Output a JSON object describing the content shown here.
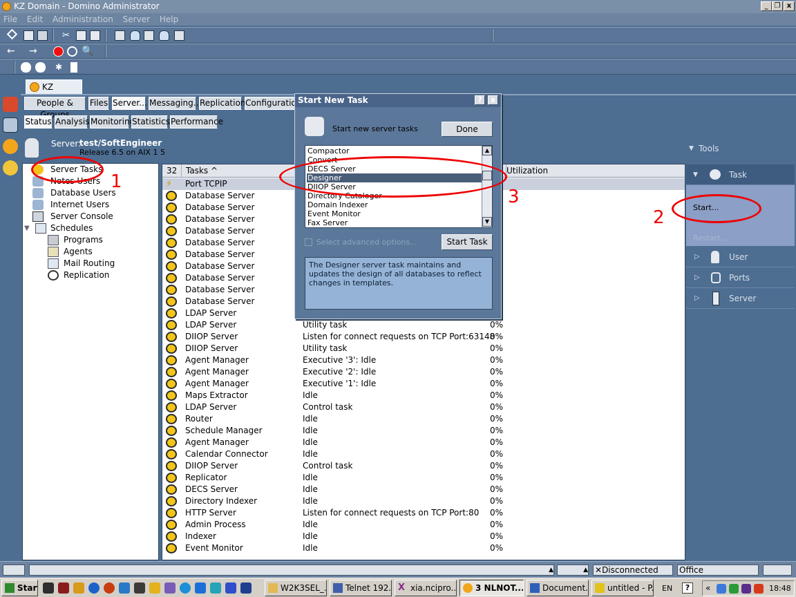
{
  "window": {
    "title": "KZ Domain - Domino Administrator",
    "min": "_",
    "max": "❐",
    "close": "x"
  },
  "menu": [
    "File",
    "Edit",
    "Administration",
    "Server",
    "Help"
  ],
  "domain_tab": "KZ Domain",
  "top_tabs": [
    "People & Groups",
    "Files",
    "Server...",
    "Messaging...",
    "Replication",
    "Configuration"
  ],
  "sub_tabs": [
    "Status",
    "Analysis",
    "Monitoring",
    "Statistics",
    "Performance"
  ],
  "server": {
    "label": "Server:",
    "name": "test/SoftEngineer",
    "release": "Release 6.5 on AIX 1 5"
  },
  "tree": {
    "items": [
      "Server Tasks",
      "Notes Users",
      "Database Users",
      "Internet Users",
      "Server Console",
      "Schedules"
    ],
    "schedule_children": [
      "Programs",
      "Agents",
      "Mail Routing",
      "Replication"
    ]
  },
  "list": {
    "count": "32",
    "headers": [
      "Tasks ^",
      "Utilization"
    ],
    "rows": [
      [
        "Port TCPIP",
        "",
        ""
      ],
      [
        "Database Server",
        "",
        ""
      ],
      [
        "Database Server",
        "",
        ""
      ],
      [
        "Database Server",
        "",
        ""
      ],
      [
        "Database Server",
        "",
        ""
      ],
      [
        "Database Server",
        "",
        ""
      ],
      [
        "Database Server",
        "",
        ""
      ],
      [
        "Database Server",
        "",
        ""
      ],
      [
        "Database Server",
        "",
        ""
      ],
      [
        "Database Server",
        "",
        ""
      ],
      [
        "Database Server",
        "",
        ""
      ],
      [
        "LDAP Server",
        "",
        ""
      ],
      [
        "LDAP Server",
        "Utility task",
        "0%"
      ],
      [
        "DIIOP Server",
        "Listen for connect requests on TCP Port:63148",
        "0%"
      ],
      [
        "DIIOP Server",
        "Utility task",
        "0%"
      ],
      [
        "Agent Manager",
        "Executive '3': Idle",
        "0%"
      ],
      [
        "Agent Manager",
        "Executive '2': Idle",
        "0%"
      ],
      [
        "Agent Manager",
        "Executive '1': Idle",
        "0%"
      ],
      [
        "Maps Extractor",
        "Idle",
        "0%"
      ],
      [
        "LDAP Server",
        "Control task",
        "0%"
      ],
      [
        "Router",
        "Idle",
        "0%"
      ],
      [
        "Schedule Manager",
        "Idle",
        "0%"
      ],
      [
        "Agent Manager",
        "Idle",
        "0%"
      ],
      [
        "Calendar Connector",
        "Idle",
        "0%"
      ],
      [
        "DIIOP Server",
        "Control task",
        "0%"
      ],
      [
        "Replicator",
        "Idle",
        "0%"
      ],
      [
        "DECS Server",
        "Idle",
        "0%"
      ],
      [
        "Directory Indexer",
        "Idle",
        "0%"
      ],
      [
        "HTTP Server",
        "Listen for connect requests on TCP Port:80",
        "0%"
      ],
      [
        "Admin Process",
        "Idle",
        "0%"
      ],
      [
        "Indexer",
        "Idle",
        "0%"
      ],
      [
        "Event Monitor",
        "Idle",
        "0%"
      ]
    ]
  },
  "tools": {
    "header": "Tools",
    "task": "Task",
    "start": "Start...",
    "restart": "Restart...",
    "user": "User",
    "ports": "Ports",
    "server": "Server"
  },
  "dialog": {
    "title": "Start New Task",
    "help": "?",
    "close": "x",
    "heading": "Start new server tasks",
    "done": "Done",
    "tasks": [
      "Compactor",
      "Convert",
      "DECS Server",
      "Designer",
      "DIIOP Server",
      "Directory Cataloger",
      "Domain Indexer",
      "Event Monitor",
      "Fax Server"
    ],
    "selected": "Designer",
    "advanced": "Select advanced options...",
    "start_task": "Start Task",
    "description": "The Designer server task maintains and updates the design of all databases to reflect changes in templates."
  },
  "statusbar": {
    "connection": "Disconnected",
    "location": "Office"
  },
  "taskbar": {
    "start": "Start",
    "buttons": [
      "W2K3SEL_...",
      "Telnet 192....",
      "xia.ncipro....",
      "3 NLNOT...",
      "Document...",
      "untitled - P..."
    ],
    "lang": "EN",
    "clock": "18:48"
  },
  "annotations": [
    "1",
    "2",
    "3"
  ]
}
